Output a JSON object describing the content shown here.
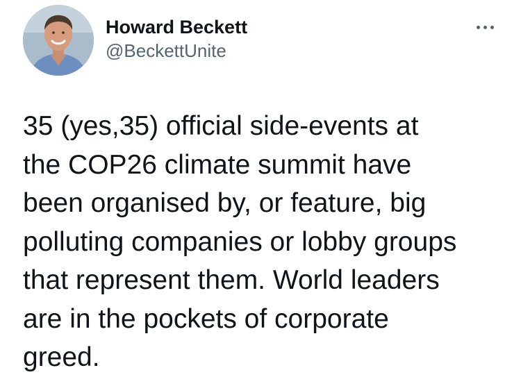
{
  "author": {
    "display_name": "Howard Beckett",
    "handle": "@BeckettUnite"
  },
  "more_icon": "more-horizontal-icon",
  "tweet": {
    "text_lines": [
      "35 (yes,35) official side-events at",
      "the COP26 climate summit have",
      "been organised by, or feature, big",
      "polluting companies or lobby groups",
      "that represent them. World leaders",
      "are in the pockets of corporate",
      "greed."
    ]
  },
  "colors": {
    "text": "#0f1419",
    "secondary_text": "#536471",
    "background": "#ffffff"
  }
}
